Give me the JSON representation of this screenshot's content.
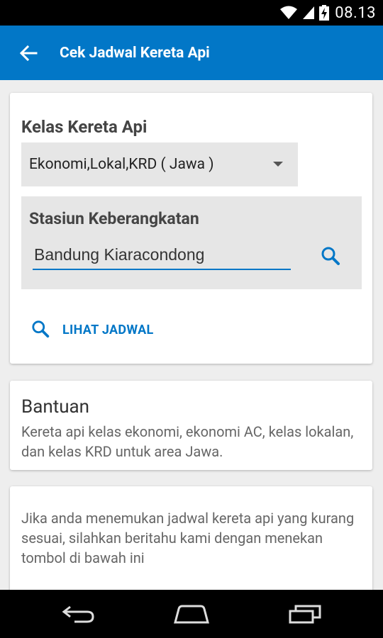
{
  "status_bar": {
    "time": "08.13"
  },
  "app_bar": {
    "title": "Cek Jadwal Kereta Api"
  },
  "form": {
    "class_label": "Kelas Kereta Api",
    "class_value": "Ekonomi,Lokal,KRD ( Jawa )",
    "station_label": "Stasiun Keberangkatan",
    "station_value": "Bandung Kiaracondong",
    "lihat_label": "LIHAT JADWAL"
  },
  "help": {
    "title": "Bantuan",
    "text": "Kereta api kelas ekonomi, ekonomi AC, kelas lokalan, dan kelas KRD untuk area Jawa."
  },
  "feedback": {
    "text": "Jika anda menemukan jadwal kereta api yang kurang sesuai, silahkan beritahu kami dengan menekan tombol di bawah ini"
  },
  "icons": {
    "back": "arrow-back-icon",
    "search": "search-icon",
    "wifi": "wifi-icon",
    "signal": "signal-icon",
    "battery": "battery-charging-icon",
    "nav_back": "nav-back-icon",
    "nav_home": "nav-home-icon",
    "nav_recents": "nav-recents-icon"
  },
  "colors": {
    "primary": "#0277c7",
    "background": "#eeeeee"
  }
}
